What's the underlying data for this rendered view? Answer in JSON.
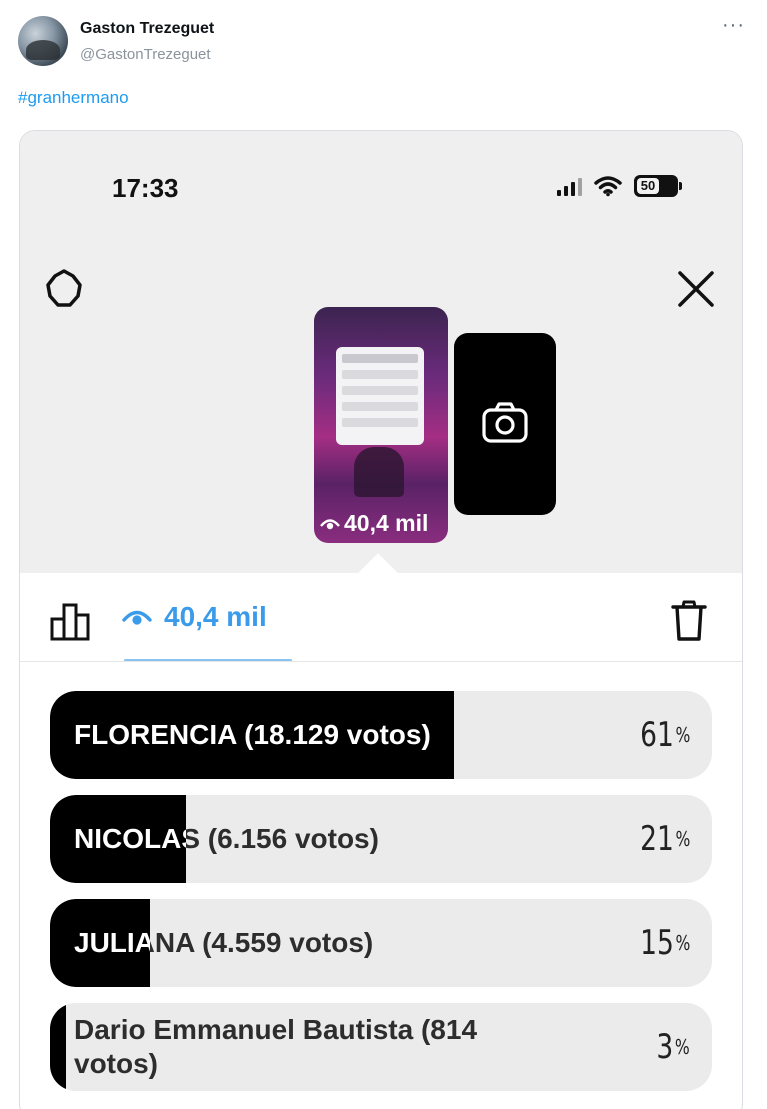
{
  "tweet": {
    "author_name": "Gaston Trezeguet",
    "author_handle": "@GastonTrezeguet",
    "hashtag": "#granhermano"
  },
  "status_bar": {
    "time": "17:33",
    "battery": "50"
  },
  "story": {
    "views": "40,4 mil"
  },
  "stats": {
    "views": "40,4 mil"
  },
  "poll": {
    "options": [
      {
        "label": "FLORENCIA (18.129 votos)",
        "percent": 61,
        "percent_label": "61",
        "symbol": "%"
      },
      {
        "label": "NICOLAS (6.156 votos)",
        "percent": 21,
        "percent_label": "21",
        "symbol": "%"
      },
      {
        "label": "JULIANA (4.559 votos)",
        "percent": 15,
        "percent_label": "15",
        "symbol": "%"
      },
      {
        "label": "Dario Emmanuel Bautista (814 votos)",
        "percent": 3,
        "percent_label": "3",
        "symbol": "%"
      }
    ]
  },
  "colors": {
    "accent": "#3a9bea",
    "link": "#1d9bf0",
    "poll_fill": "#000000",
    "poll_track": "#ebebeb"
  },
  "icons": [
    "more-icon",
    "settings-icon",
    "close-icon",
    "camera-icon",
    "eye-icon",
    "bar-chart-icon",
    "trash-icon",
    "signal-icon",
    "wifi-icon",
    "battery-icon"
  ]
}
